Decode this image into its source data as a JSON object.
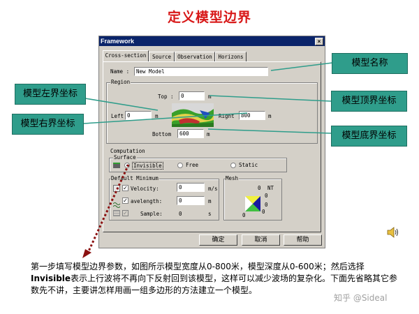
{
  "slide": {
    "title": "定义模型边界",
    "description_before": "第一步填写模型边界参数，如图所示模型宽度从0-800米，模型深度从0-600米；然后选择",
    "description_bold": "Invisible",
    "description_after": "表示上行波将不再向下反射回到该模型，这样可以减少波场的复杂化。下面先省略其它参数先不讲，主要讲怎样用画一组多边形的方法建立一个模型。",
    "watermark": "知乎 @Sideal"
  },
  "dialog": {
    "title": "Framework",
    "close_label": "×",
    "tabs": [
      "Cross-section",
      "Source",
      "Observation",
      "Horizons"
    ],
    "name_label": "Name :",
    "name_value": "New Model",
    "region": {
      "title": "Region",
      "top_label": "Top :",
      "top_value": "0",
      "top_unit": "m",
      "left_label": "Left",
      "left_value": "0",
      "left_unit": "m",
      "right_label": "Right",
      "right_value": "800",
      "right_unit": "m",
      "bottom_label": "Bottom",
      "bottom_value": "600",
      "bottom_unit": "m"
    },
    "computation": {
      "title": "Computation",
      "surface_title": "Surface",
      "options": [
        "Invisible",
        "Free",
        "Static"
      ],
      "selected": "Invisible"
    },
    "default_minimum": {
      "title": "Default Minimum",
      "velocity_label": "Velocity:",
      "velocity_value": "0",
      "velocity_unit": "m/s",
      "wavelength_label": "avelength:",
      "wavelength_value": "0",
      "wavelength_unit": "m",
      "sample_label": "Sample:",
      "sample_value": "0",
      "sample_unit": "s"
    },
    "mesh": {
      "title": "Mesh",
      "nt_value": "0",
      "nt_label": "NT",
      "v1": "0",
      "v2": "0",
      "v3": "0",
      "v4": "0"
    },
    "buttons": {
      "ok": "确定",
      "cancel": "取消",
      "help": "帮助"
    }
  },
  "callouts": {
    "model_name": "模型名称",
    "left_coord": "模型左界坐标",
    "right_coord": "模型右界坐标",
    "top_coord": "模型顶界坐标",
    "bottom_coord": "模型底界坐标"
  },
  "colors": {
    "title_red": "#d81818",
    "callout_teal": "#2f9d8b",
    "dialog_gray": "#d4d0c8",
    "titlebar_blue": "#0a246a",
    "arrow_red": "#8b1010"
  },
  "icons": [
    "speaker-icon",
    "model-preview-image",
    "mesh-icon"
  ]
}
